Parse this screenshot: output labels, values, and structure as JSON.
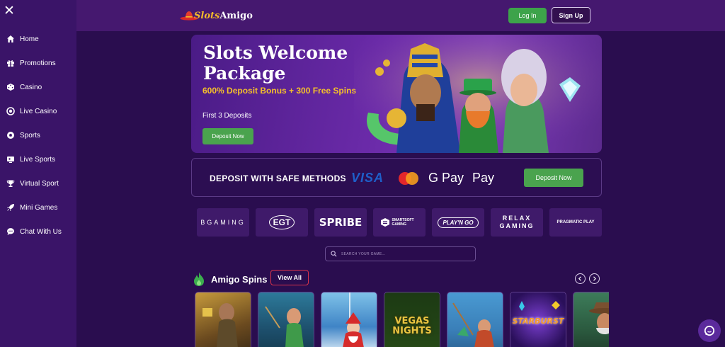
{
  "sidebar": {
    "close_icon": "close-icon",
    "items": [
      {
        "label": "Home",
        "icon": "home-icon"
      },
      {
        "label": "Promotions",
        "icon": "gift-icon"
      },
      {
        "label": "Casino",
        "icon": "dice-icon"
      },
      {
        "label": "Live Casino",
        "icon": "chip-icon"
      },
      {
        "label": "Sports",
        "icon": "soccer-ball-icon"
      },
      {
        "label": "Live Sports",
        "icon": "live-tv-icon"
      },
      {
        "label": "Virtual Sport",
        "icon": "trophy-icon"
      },
      {
        "label": "Mini Games",
        "icon": "rocket-icon"
      },
      {
        "label": "Chat With Us",
        "icon": "chat-icon"
      }
    ]
  },
  "header": {
    "logo_text_1": "Slots",
    "logo_text_2": "Amigo",
    "login_label": "Log In",
    "signup_label": "Sign Up"
  },
  "banner": {
    "title": "Slots Welcome Package",
    "subtitle": "600% Deposit Bonus + 300 Free Spins",
    "note": "First 3 Deposits",
    "button_label": "Deposit Now"
  },
  "deposit": {
    "text": "DEPOSIT WITH SAFE METHODS",
    "visa": "VISA",
    "mastercard": "mastercard",
    "gpay": "G Pay",
    "apay": " Pay",
    "button_label": "Deposit Now"
  },
  "providers": [
    {
      "name": "BGAMING"
    },
    {
      "name": "EGT"
    },
    {
      "name": "SPRIBE"
    },
    {
      "name": "SMARTSOFT GAMING"
    },
    {
      "name": "PLAY'N GO"
    },
    {
      "name": "RELAX GAMING"
    },
    {
      "name": "PRAGMATIC PLAY"
    }
  ],
  "search": {
    "placeholder": "SEARCH YOUR GAME..."
  },
  "section": {
    "title": "Amigo Spins",
    "view_all": "View All"
  },
  "games": [
    {
      "title": ""
    },
    {
      "title": ""
    },
    {
      "title": ""
    },
    {
      "title": "VEGAS NIGHTS"
    },
    {
      "title": ""
    },
    {
      "title": "STARBURST"
    },
    {
      "title": ""
    }
  ],
  "colors": {
    "background": "#2a0d4f",
    "sidebar": "#3a1468",
    "header": "#45186f",
    "accent_green": "#4aa34e",
    "accent_gold": "#f5c02a",
    "view_all_border": "#d8334a"
  }
}
